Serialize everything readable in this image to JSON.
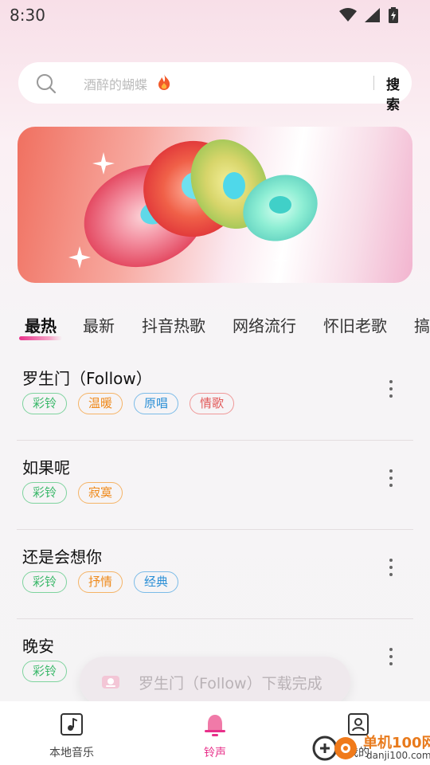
{
  "status_bar": {
    "time": "8:30"
  },
  "search": {
    "placeholder": "酒醉的蝴蝶",
    "button_label": "搜索"
  },
  "tabs": [
    {
      "label": "最热",
      "active": true
    },
    {
      "label": "最新"
    },
    {
      "label": "抖音热歌"
    },
    {
      "label": "网络流行"
    },
    {
      "label": "怀旧老歌"
    },
    {
      "label": "搞"
    }
  ],
  "songs": [
    {
      "title": "罗生门（Follow）",
      "tags": [
        {
          "label": "彩铃",
          "color": "green"
        },
        {
          "label": "温暖",
          "color": "orange"
        },
        {
          "label": "原唱",
          "color": "blue"
        },
        {
          "label": "情歌",
          "color": "red"
        }
      ]
    },
    {
      "title": "如果呢",
      "tags": [
        {
          "label": "彩铃",
          "color": "green"
        },
        {
          "label": "寂寞",
          "color": "orange"
        }
      ]
    },
    {
      "title": "还是会想你",
      "tags": [
        {
          "label": "彩铃",
          "color": "green"
        },
        {
          "label": "抒情",
          "color": "orange"
        },
        {
          "label": "经典",
          "color": "blue"
        }
      ]
    },
    {
      "title": "晚安",
      "tags": [
        {
          "label": "彩铃",
          "color": "green"
        }
      ]
    }
  ],
  "toast": {
    "text": "罗生门（Follow）下载完成"
  },
  "bottom_nav": [
    {
      "label": "本地音乐",
      "icon": "music-note-icon"
    },
    {
      "label": "铃声",
      "icon": "bell-icon",
      "active": true
    },
    {
      "label": "我的",
      "icon": "profile-icon"
    }
  ],
  "watermark": {
    "brand": "单机100网",
    "url": "danji100.com"
  },
  "colors": {
    "accent": "#e8308a",
    "green": "#3bb86a",
    "orange": "#ef8a1c",
    "blue": "#2b8fd6",
    "red": "#e25a5a"
  }
}
